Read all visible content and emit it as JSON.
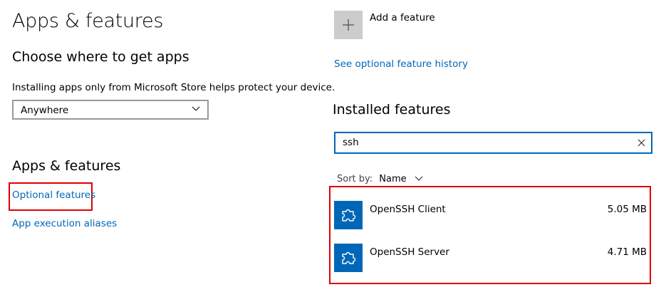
{
  "left": {
    "page_title": "Apps & features",
    "choose_heading": "Choose where to get apps",
    "choose_desc": "Installing apps only from Microsoft Store helps protect your device.",
    "source_dropdown_value": "Anywhere",
    "apps_heading": "Apps & features",
    "optional_features_link": "Optional features",
    "app_execution_aliases_link": "App execution aliases"
  },
  "right": {
    "add_feature_label": "Add a feature",
    "history_link": "See optional feature history",
    "installed_heading": "Installed features",
    "search_value": "ssh",
    "sort_label": "Sort by:",
    "sort_value": "Name",
    "features": [
      {
        "name": "OpenSSH Client",
        "size": "5.05 MB",
        "icon": "puzzle-icon"
      },
      {
        "name": "OpenSSH Server",
        "size": "4.71 MB",
        "icon": "puzzle-icon"
      }
    ]
  },
  "colors": {
    "accent": "#0067b8",
    "highlight": "#e00000"
  }
}
